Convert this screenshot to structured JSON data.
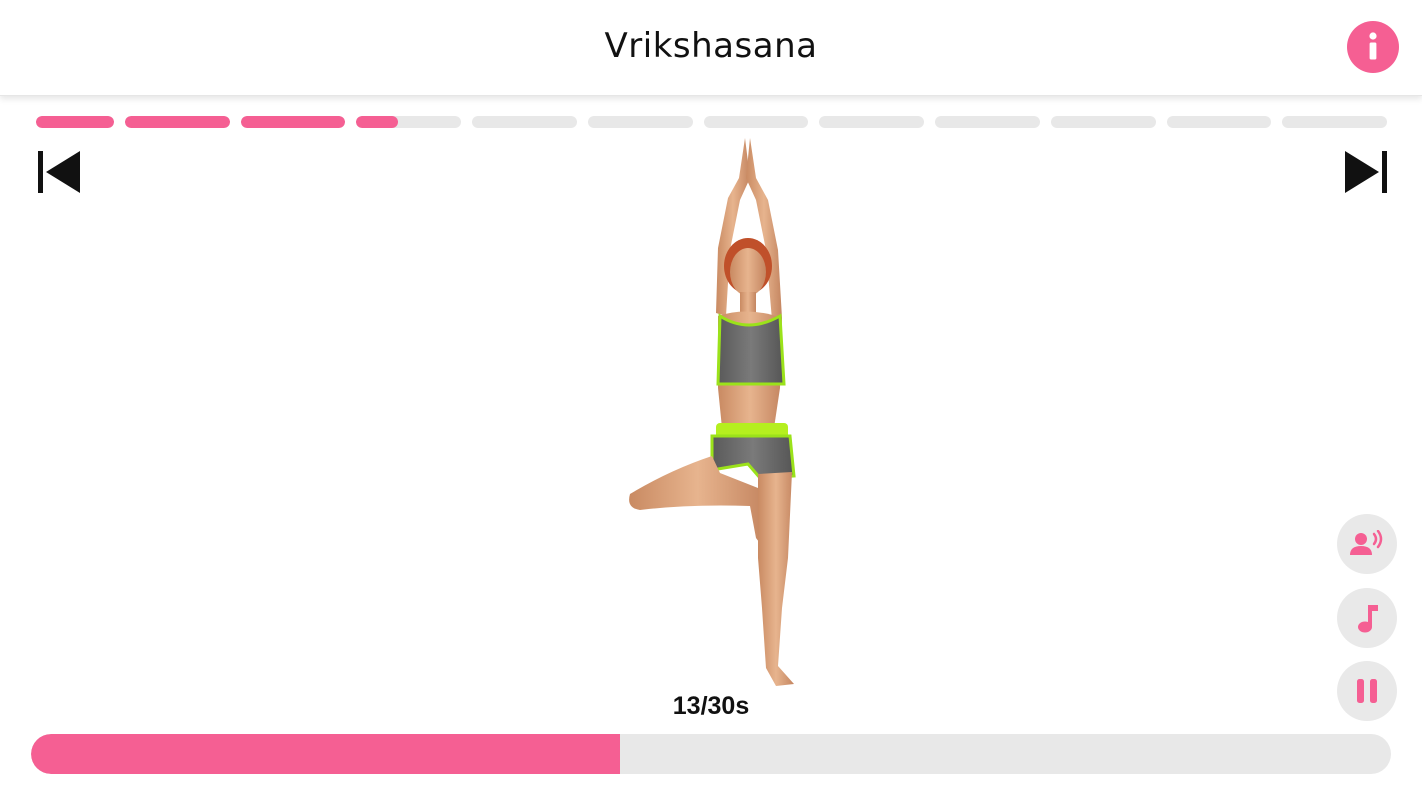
{
  "header": {
    "title": "Vrikshasana"
  },
  "colors": {
    "accent": "#f55f93",
    "track": "#e8e8e8",
    "text": "#111111",
    "control_bg": "#e9e9e9"
  },
  "exercise_sequence": {
    "total_segments": 12,
    "completed_segments": 3,
    "current_segment_progress": 0.4
  },
  "timer": {
    "elapsed": 13,
    "total": 30,
    "label": "13/30s",
    "progress": 0.433
  },
  "icons": {
    "info": "info-icon",
    "previous": "skip-previous-icon",
    "next": "skip-next-icon",
    "voice": "voice-guide-icon",
    "music": "music-note-icon",
    "pause": "pause-icon"
  }
}
